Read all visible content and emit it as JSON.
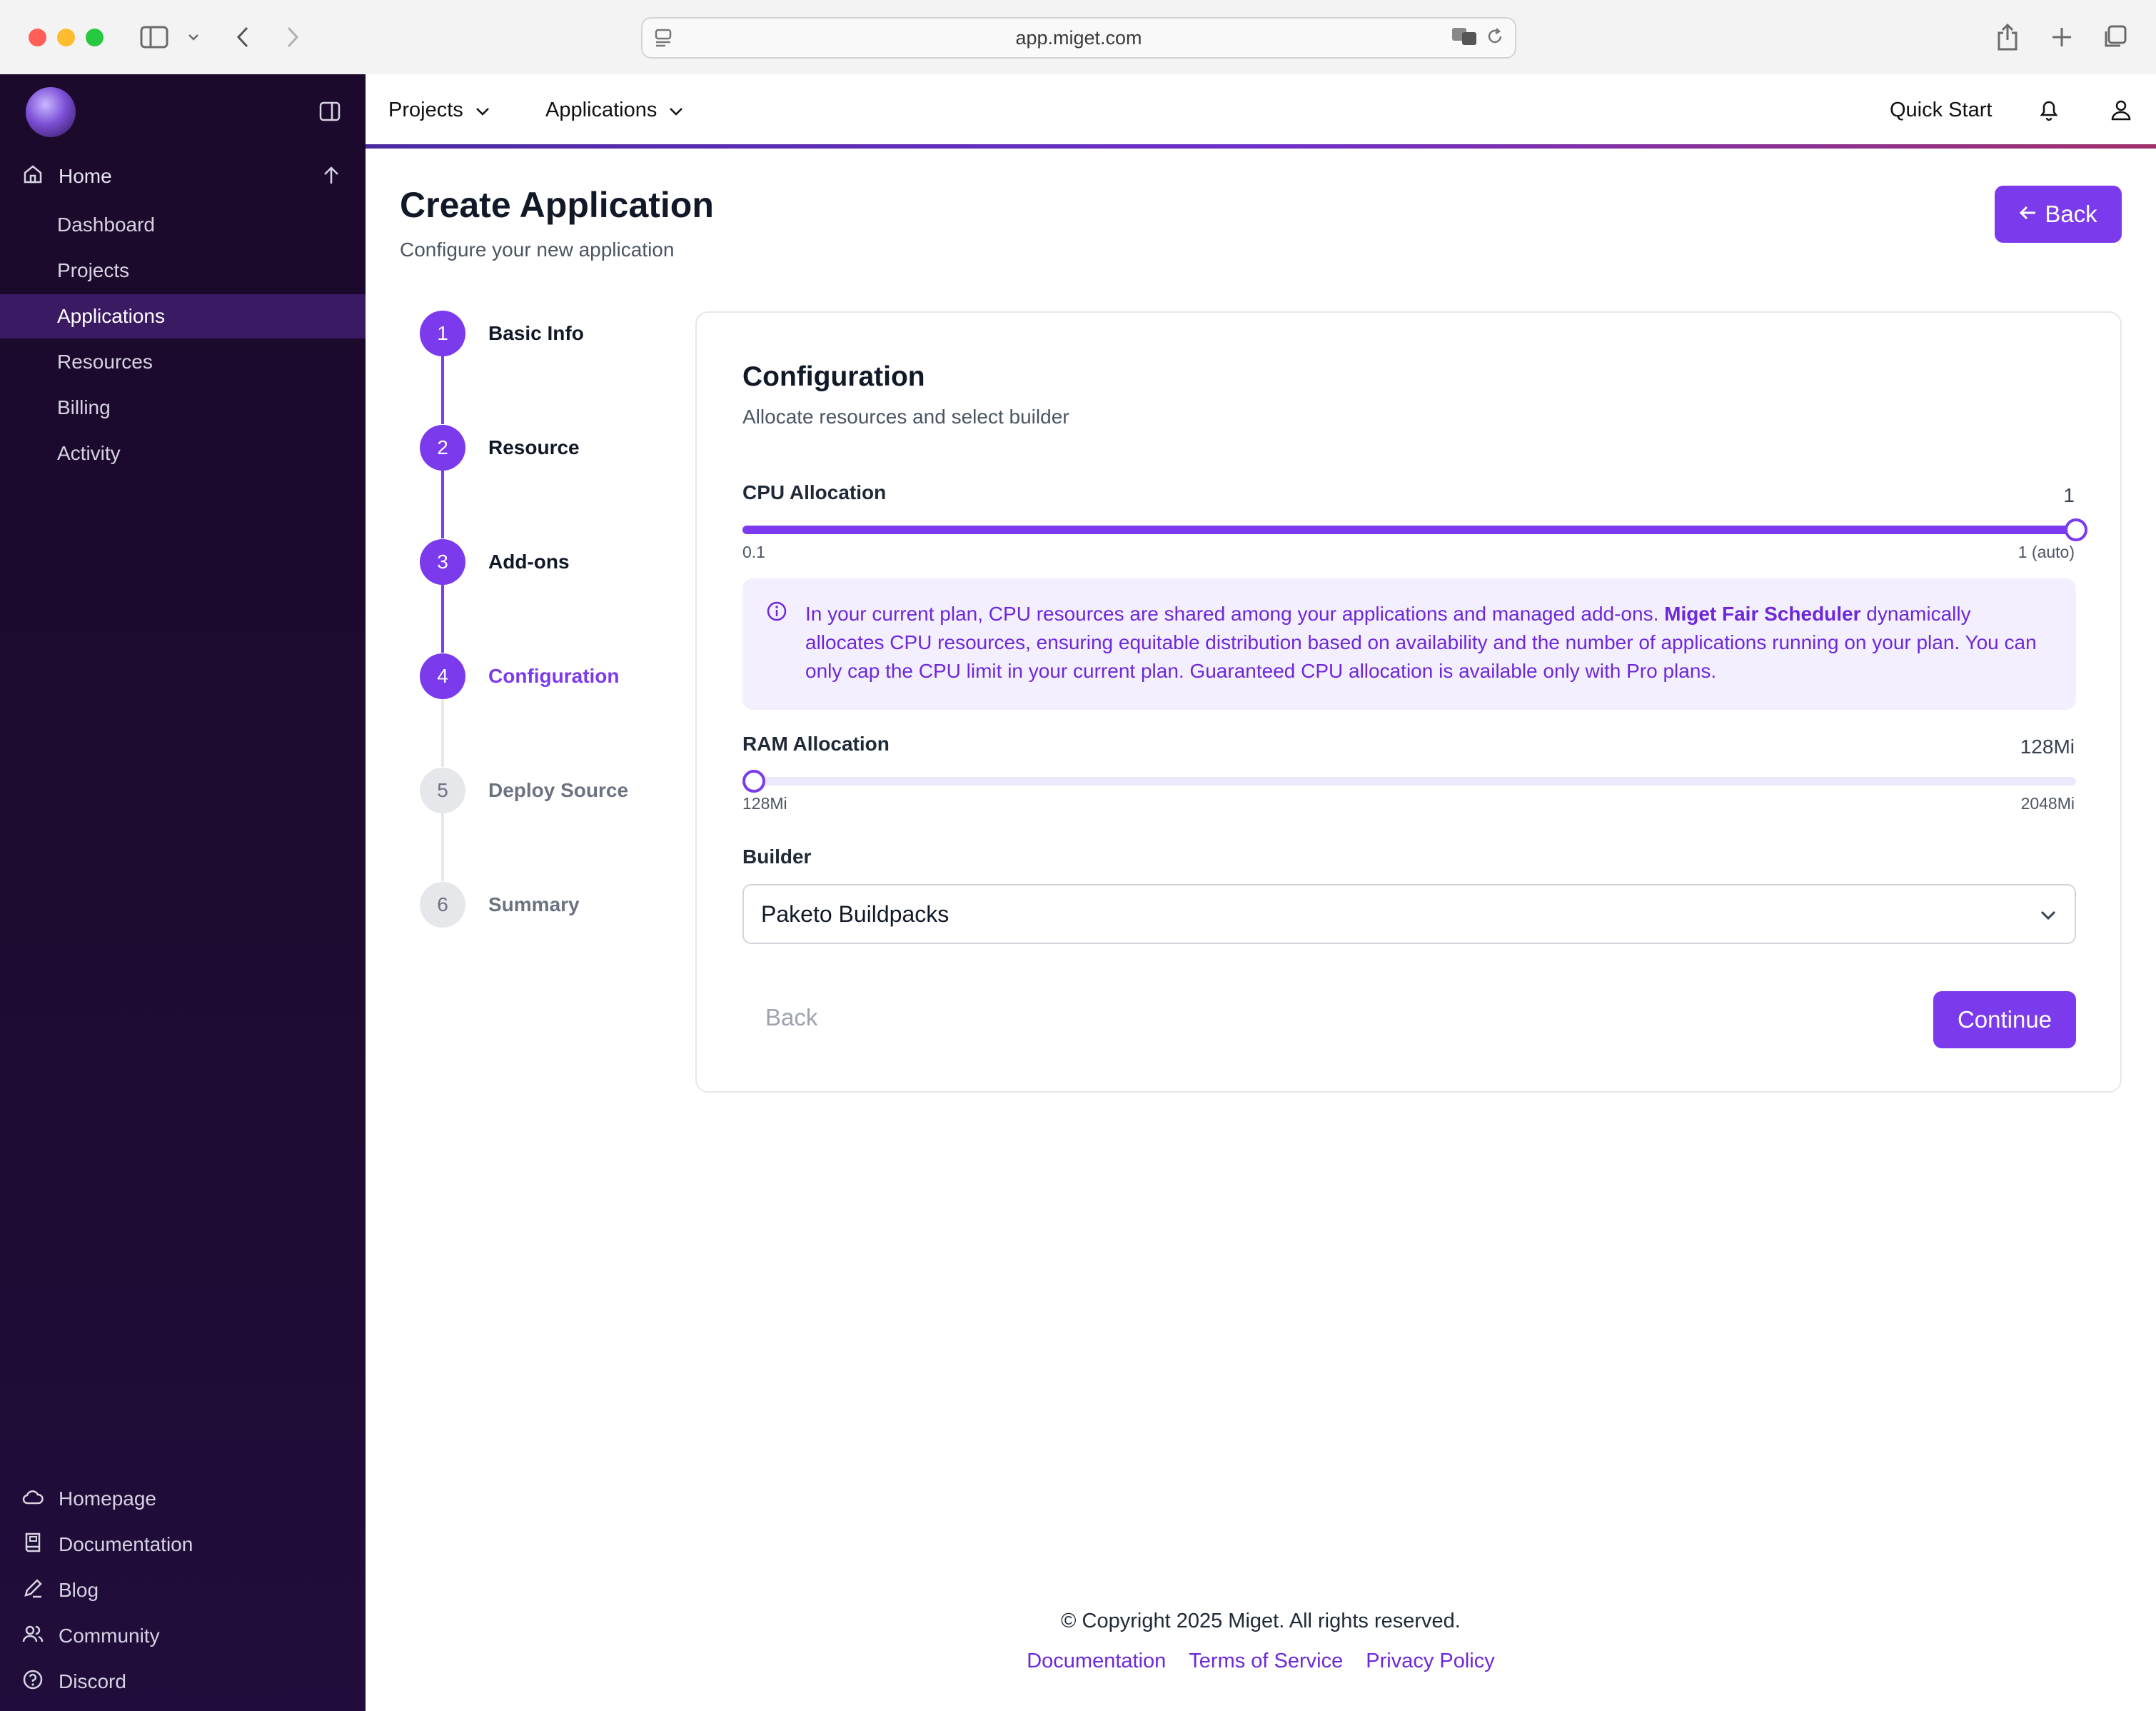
{
  "browser": {
    "url": "app.miget.com"
  },
  "sidebar": {
    "home_label": "Home",
    "items": [
      {
        "label": "Dashboard",
        "active": false
      },
      {
        "label": "Projects",
        "active": false
      },
      {
        "label": "Applications",
        "active": true
      },
      {
        "label": "Resources",
        "active": false
      },
      {
        "label": "Billing",
        "active": false
      },
      {
        "label": "Activity",
        "active": false
      }
    ],
    "footer_items": [
      {
        "label": "Homepage",
        "icon": "cloud-icon"
      },
      {
        "label": "Documentation",
        "icon": "book-icon"
      },
      {
        "label": "Blog",
        "icon": "pen-icon"
      },
      {
        "label": "Community",
        "icon": "users-icon"
      },
      {
        "label": "Discord",
        "icon": "help-circle-icon"
      }
    ]
  },
  "topbar": {
    "projects_label": "Projects",
    "applications_label": "Applications",
    "quick_start_label": "Quick Start"
  },
  "page": {
    "title": "Create Application",
    "subtitle": "Configure your new application",
    "back_label": "Back"
  },
  "steps": [
    {
      "number": "1",
      "label": "Basic Info",
      "state": "done"
    },
    {
      "number": "2",
      "label": "Resource",
      "state": "done"
    },
    {
      "number": "3",
      "label": "Add-ons",
      "state": "done"
    },
    {
      "number": "4",
      "label": "Configuration",
      "state": "current"
    },
    {
      "number": "5",
      "label": "Deploy Source",
      "state": "pending"
    },
    {
      "number": "6",
      "label": "Summary",
      "state": "pending"
    }
  ],
  "config": {
    "title": "Configuration",
    "subtitle": "Allocate resources and select builder",
    "cpu": {
      "label": "CPU Allocation",
      "value": "1",
      "min_label": "0.1",
      "max_label": "1 (auto)",
      "fraction": 1.0
    },
    "info": {
      "part1": "In your current plan, CPU resources are shared among your applications and managed add-ons. ",
      "bold": "Miget Fair Scheduler",
      "part2": " dynamically allocates CPU resources, ensuring equitable distribution based on availability and the number of applications running on your plan. You can only cap the CPU limit in your current plan. Guaranteed CPU allocation is available only with Pro plans."
    },
    "ram": {
      "label": "RAM Allocation",
      "value": "128Mi",
      "min_label": "128Mi",
      "max_label": "2048Mi",
      "fraction": 0.0
    },
    "builder": {
      "label": "Builder",
      "selected": "Paketo Buildpacks"
    },
    "back_label": "Back",
    "continue_label": "Continue"
  },
  "footer": {
    "copyright": "© Copyright 2025 Miget. All rights reserved.",
    "links": [
      "Documentation",
      "Terms of Service",
      "Privacy Policy"
    ]
  },
  "colors": {
    "accent": "#7c3aed",
    "sidebar_bg": "#1d0b30",
    "sidebar_active": "#3a1a63"
  }
}
